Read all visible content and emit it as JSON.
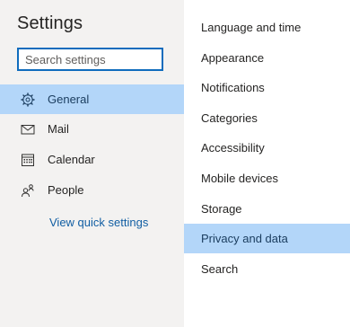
{
  "panel": {
    "title": "Settings"
  },
  "search": {
    "placeholder": "Search settings",
    "value": ""
  },
  "nav": {
    "items": [
      {
        "label": "General",
        "icon": "gear-icon",
        "active": true
      },
      {
        "label": "Mail",
        "icon": "envelope-icon",
        "active": false
      },
      {
        "label": "Calendar",
        "icon": "calendar-icon",
        "active": false
      },
      {
        "label": "People",
        "icon": "people-icon",
        "active": false
      }
    ],
    "quick_settings_label": "View quick settings"
  },
  "submenu": {
    "items": [
      {
        "label": "Language and time",
        "active": false
      },
      {
        "label": "Appearance",
        "active": false
      },
      {
        "label": "Notifications",
        "active": false
      },
      {
        "label": "Categories",
        "active": false
      },
      {
        "label": "Accessibility",
        "active": false
      },
      {
        "label": "Mobile devices",
        "active": false
      },
      {
        "label": "Storage",
        "active": false
      },
      {
        "label": "Privacy and data",
        "active": true
      },
      {
        "label": "Search",
        "active": false
      }
    ]
  },
  "colors": {
    "accent": "#0f6cbd",
    "selected_bg": "#b3d6f9",
    "link": "#115ea3",
    "left_bg": "#f3f2f1"
  }
}
